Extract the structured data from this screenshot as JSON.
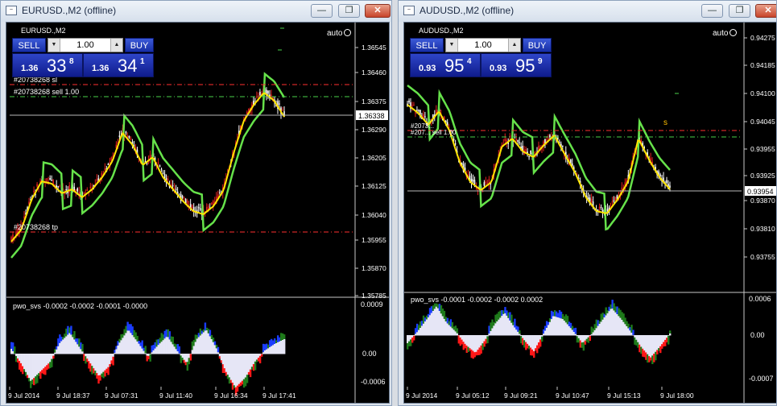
{
  "colors": {
    "bull": "#e02020",
    "bear": "#ffffff",
    "ma": "#ffe500",
    "env": "#66e24a",
    "osc_pos": "#1a3cff",
    "osc_neg": "#ff1818",
    "osc_green": "#1e7a1a",
    "osc_white": "#e6e6f6",
    "sl_line": "#ff3030",
    "entry_line": "#4ad24a",
    "price_line": "#b8b8b8"
  },
  "windows": [
    {
      "title": "EURUSD.,M2 (offline)",
      "symbol_label": "EURUSD.,M2",
      "auto_label": "auto",
      "panel": {
        "sell_label": "SELL",
        "buy_label": "BUY",
        "lot": "1.00",
        "bid_big": "1.36",
        "bid_pips": "33",
        "bid_frac": "8",
        "ask_big": "1.36",
        "ask_pips": "34",
        "ask_frac": "1"
      },
      "price_labels": [
        "1.36545",
        "1.36460",
        "1.36375",
        "1.36290",
        "1.36205",
        "1.36125",
        "1.36040",
        "1.35955",
        "1.35870",
        "1.35785"
      ],
      "current_price": "1.36338",
      "order_labels": {
        "sl": "#20738268 sl",
        "entry": "#20738268 sell 1.00",
        "tp": "#20738268 tp"
      },
      "indicator_label": "pwo_svs -0.0002 -0.0002 -0.0001 -0.0000",
      "indicator_scale": [
        "0.0009",
        "0.00",
        "-0.0006"
      ],
      "time_labels": [
        "9 Jul 2014",
        "9 Jul 18:37",
        "9 Jul 07:31",
        "9 Jul 11:40",
        "9 Jul 16:34",
        "9 Jul 17:41"
      ]
    },
    {
      "title": "AUDUSD.,M2 (offline)",
      "symbol_label": "AUDUSD.,M2",
      "auto_label": "auto",
      "panel": {
        "sell_label": "SELL",
        "buy_label": "BUY",
        "lot": "1.00",
        "bid_big": "0.93",
        "bid_pips": "95",
        "bid_frac": "4",
        "ask_big": "0.93",
        "ask_pips": "95",
        "ask_frac": "9"
      },
      "price_labels": [
        "0.94275",
        "0.94185",
        "0.94100",
        "0.94045",
        "0.93955",
        "0.93925",
        "0.93870",
        "0.93810",
        "0.93755"
      ],
      "current_price": "0.93954",
      "order_labels": {
        "sl": "#2073...",
        "entry": "#207... sell 1.00",
        "tp": ""
      },
      "indicator_label": "pwo_svs -0.0001 -0.0002 -0.0002 0.0002",
      "indicator_scale": [
        "0.0006",
        "0.00",
        "-0.0007"
      ],
      "time_labels": [
        "9 Jul 2014",
        "9 Jul 05:12",
        "9 Jul 09:21",
        "9 Jul 10:47",
        "9 Jul 15:13",
        "9 Jul 18:00"
      ]
    }
  ]
}
